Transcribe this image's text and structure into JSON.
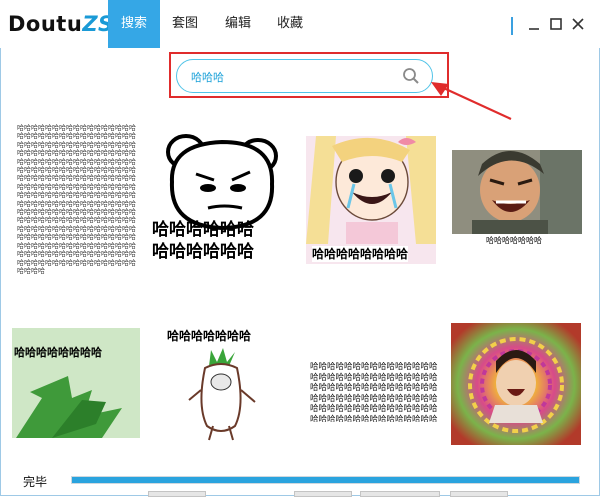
{
  "app": {
    "logo_main": "Doutu",
    "logo_suffix": "ZS"
  },
  "tabs": [
    {
      "label": "搜索",
      "active": true
    },
    {
      "label": "套图",
      "active": false
    },
    {
      "label": "编辑",
      "active": false
    },
    {
      "label": "收藏",
      "active": false
    }
  ],
  "search": {
    "value": "哈哈哈",
    "placeholder": ""
  },
  "results": {
    "r1_text_block": "哈哈哈哈哈哈哈哈哈哈哈哈哈哈哈哈哈哈哈哈哈哈哈哈哈哈哈哈哈哈哈哈哈哈哈哈哈哈哈哈哈哈哈哈哈哈哈哈哈哈哈哈哈哈哈哈哈哈哈哈哈哈哈哈哈哈哈哈哈哈哈哈哈哈哈哈哈哈哈哈哈哈哈哈哈哈哈哈哈哈哈哈哈哈哈哈哈哈哈哈哈哈哈哈哈哈哈哈哈哈哈哈哈哈哈哈哈哈哈哈哈哈哈哈哈哈哈哈哈哈哈哈哈哈哈哈哈哈哈哈哈哈哈哈哈哈哈哈哈哈哈哈哈哈哈哈哈哈哈哈哈哈哈哈哈哈哈哈哈哈哈哈哈哈哈哈哈哈哈哈哈哈哈哈哈哈哈哈哈哈哈哈哈哈哈哈哈哈哈哈哈哈哈哈哈哈哈哈哈哈哈哈哈哈哈哈哈哈哈哈哈哈哈哈哈哈哈哈哈哈哈哈哈哈哈哈哈哈哈哈哈哈哈哈哈哈哈哈哈哈哈哈哈哈哈哈哈哈哈哈哈哈哈哈哈哈哈哈哈哈哈哈哈哈哈哈哈哈哈哈哈哈哈哈哈哈哈哈哈哈哈哈哈",
    "r2_line1": "哈哈哈哈哈哈",
    "r2_line2": "哈哈哈哈哈哈",
    "r3_caption": "哈哈哈哈哈哈哈哈",
    "r4_caption": "哈哈哈哈哈哈哈",
    "r5_caption": "哈哈哈哈哈哈哈哈",
    "r6_caption": "哈哈哈哈哈哈哈",
    "r7_text_block": "哈哈哈哈哈哈哈哈哈哈哈哈哈哈哈哈哈哈哈哈哈哈哈哈哈哈哈哈哈哈哈哈哈哈哈哈哈哈哈哈哈哈哈哈哈哈哈哈哈哈哈哈哈哈哈哈哈哈哈哈哈哈哈哈哈哈哈哈哈哈哈哈哈哈哈哈哈哈哈哈哈哈哈哈哈哈哈哈哈哈哈哈哈哈哈哈哈哈哈哈哈哈哈哈哈哈哈哈哈哈哈哈哈哈哈哈哈哈哈哈哈哈哈哈哈哈哈哈哈哈哈哈哈哈哈哈哈哈哈哈哈哈哈哈哈哈哈哈哈哈哈哈哈哈哈哈哈哈哈哈哈哈哈哈哈哈哈哈哈哈哈哈哈哈哈哈哈哈哈哈哈哈哈哈哈哈哈哈哈哈哈哈哈哈哈哈哈哈嘛。"
  },
  "status": {
    "label": "完毕",
    "progress": 1.0
  },
  "colors": {
    "accent": "#35a7e6",
    "highlight_box": "#e02c2c",
    "search_text": "#19a0d8"
  }
}
